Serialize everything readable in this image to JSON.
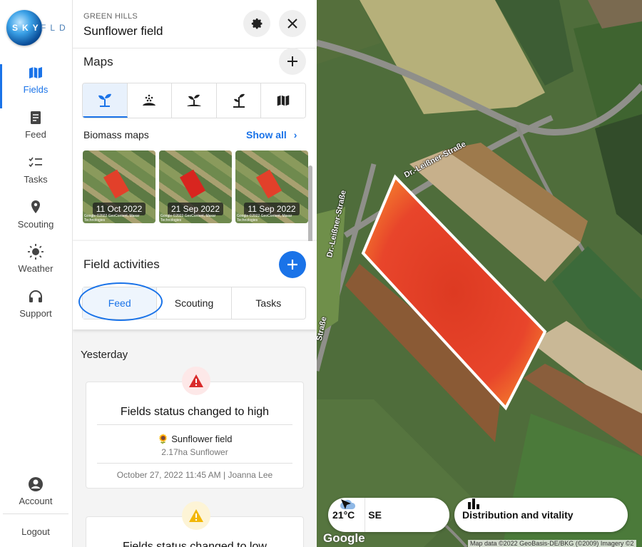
{
  "brand": {
    "logo_text": "SKYFLD"
  },
  "nav": {
    "items": [
      {
        "label": "Fields",
        "icon": "map-icon"
      },
      {
        "label": "Feed",
        "icon": "document-icon"
      },
      {
        "label": "Tasks",
        "icon": "checklist-icon"
      },
      {
        "label": "Scouting",
        "icon": "location-pin-icon"
      },
      {
        "label": "Weather",
        "icon": "sun-icon"
      },
      {
        "label": "Support",
        "icon": "headset-icon"
      }
    ],
    "account": "Account",
    "logout": "Logout"
  },
  "header": {
    "farm": "GREEN HILLS",
    "field": "Sunflower field"
  },
  "maps": {
    "title": "Maps",
    "tabs": [
      "plant-icon",
      "seeding-icon",
      "sprout-soil-icon",
      "plant-growth-icon",
      "map-icon"
    ],
    "active_tab": 0,
    "biomass_label": "Biomass maps",
    "show_all": "Show all",
    "thumbs": [
      "11 Oct 2022",
      "21 Sep 2022",
      "11 Sep 2022"
    ],
    "thumb_credit": "Google ©2022 GeoContent, Maxar Technologies"
  },
  "activities": {
    "title": "Field activities",
    "tabs": [
      "Feed",
      "Scouting",
      "Tasks"
    ],
    "active_tab": "Feed"
  },
  "feed": {
    "day": "Yesterday",
    "cards": [
      {
        "title": "Fields status changed to high",
        "level_color": "#d92b2b",
        "field": "🌻 Sunflower field",
        "detail": "2.17ha Sunflower",
        "meta": "October 27, 2022 11:45 AM | Joanna Lee"
      },
      {
        "title": "Fields status changed to low",
        "level_color": "#f2b705"
      }
    ]
  },
  "map": {
    "road_label": "Dr.-Leißner-Straße",
    "road_label_2": "Dr.-Leißner-Straße",
    "road_label_3": "Straße",
    "weather_temp": "21°C",
    "wind_dir": "SE",
    "distribution_button": "Distribution and vitality",
    "google": "Google",
    "attribution": "Map data ©2022 GeoBasis-DE/BKG (©2009) Imagery ©2"
  },
  "colors": {
    "accent": "#1a73e8",
    "field_fill": "#e8452b"
  }
}
